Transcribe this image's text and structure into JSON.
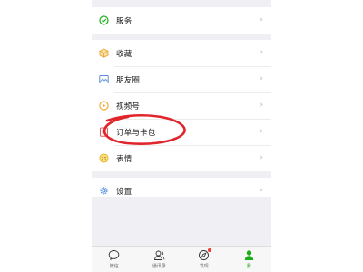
{
  "menu_groups": [
    {
      "items": [
        {
          "icon": "service-icon",
          "label": "服务"
        }
      ]
    },
    {
      "items": [
        {
          "icon": "favorites-icon",
          "label": "收藏"
        },
        {
          "icon": "moments-icon",
          "label": "朋友圈"
        },
        {
          "icon": "channels-icon",
          "label": "视频号"
        },
        {
          "icon": "cards-icon",
          "label": "订单与卡包"
        },
        {
          "icon": "sticker-icon",
          "label": "表情"
        }
      ]
    },
    {
      "items": [
        {
          "icon": "settings-icon",
          "label": "设置"
        }
      ]
    }
  ],
  "chevron": "›",
  "tabbar": {
    "tabs": [
      {
        "icon": "chat-icon",
        "label": "微信"
      },
      {
        "icon": "contacts-icon",
        "label": "通讯录"
      },
      {
        "icon": "discover-icon",
        "label": "发现",
        "badge": true
      },
      {
        "icon": "me-icon",
        "label": "我",
        "active": true
      }
    ]
  },
  "colors": {
    "brand_green": "#1aad19",
    "annotation_red": "#e0252b",
    "badge_red": "#f43530"
  }
}
